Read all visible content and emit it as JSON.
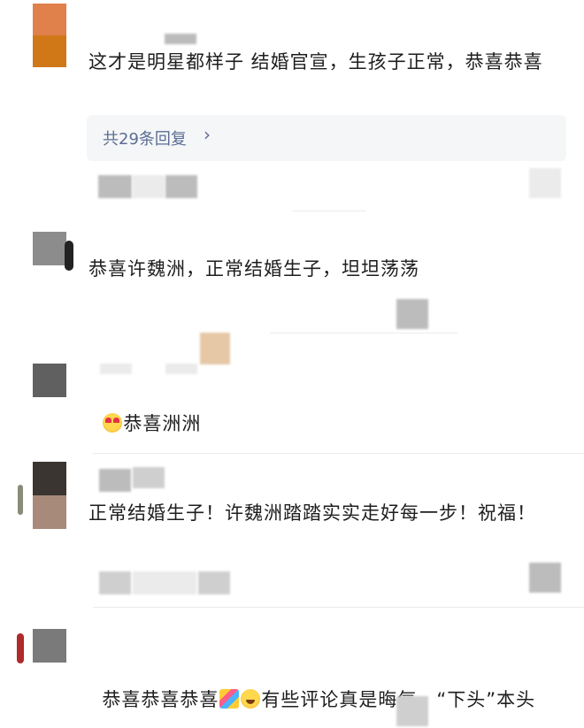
{
  "comments": [
    {
      "text": "这才是明星都样子 结婚官宣，生孩子正常，恭喜恭喜",
      "reply_label": "共29条回复",
      "reply_chevron": "›",
      "avatar_colors": [
        "#e0804a",
        "#d07818"
      ]
    },
    {
      "text": "恭喜许魏洲，正常结婚生子，坦坦荡荡",
      "avatar_colors": [
        "#8c8c8c",
        "#ffffff"
      ]
    },
    {
      "text_parts": [
        "恭喜洲洲"
      ],
      "emoji": [
        "smiling-face-with-hearts-emoji"
      ],
      "avatar_colors": [
        "#606060",
        "#ffffff"
      ]
    },
    {
      "text": "正常结婚生子！许魏洲踏踏实实走好每一步！祝福！",
      "avatar_colors": [
        "#3a3530",
        "#a88a7a"
      ]
    },
    {
      "text_parts": [
        "恭喜恭喜恭喜",
        "有些评论真是晦气，“下头”本头"
      ],
      "emoji": [
        "party-popper-emoji",
        "grinning-face-emoji"
      ],
      "avatar_colors": [
        "#7a7a7a",
        "#ffffff"
      ]
    }
  ],
  "colors": {
    "reply_link": "#5a6d93",
    "reply_bg": "#f5f6f7",
    "text": "#1e1e1e"
  }
}
